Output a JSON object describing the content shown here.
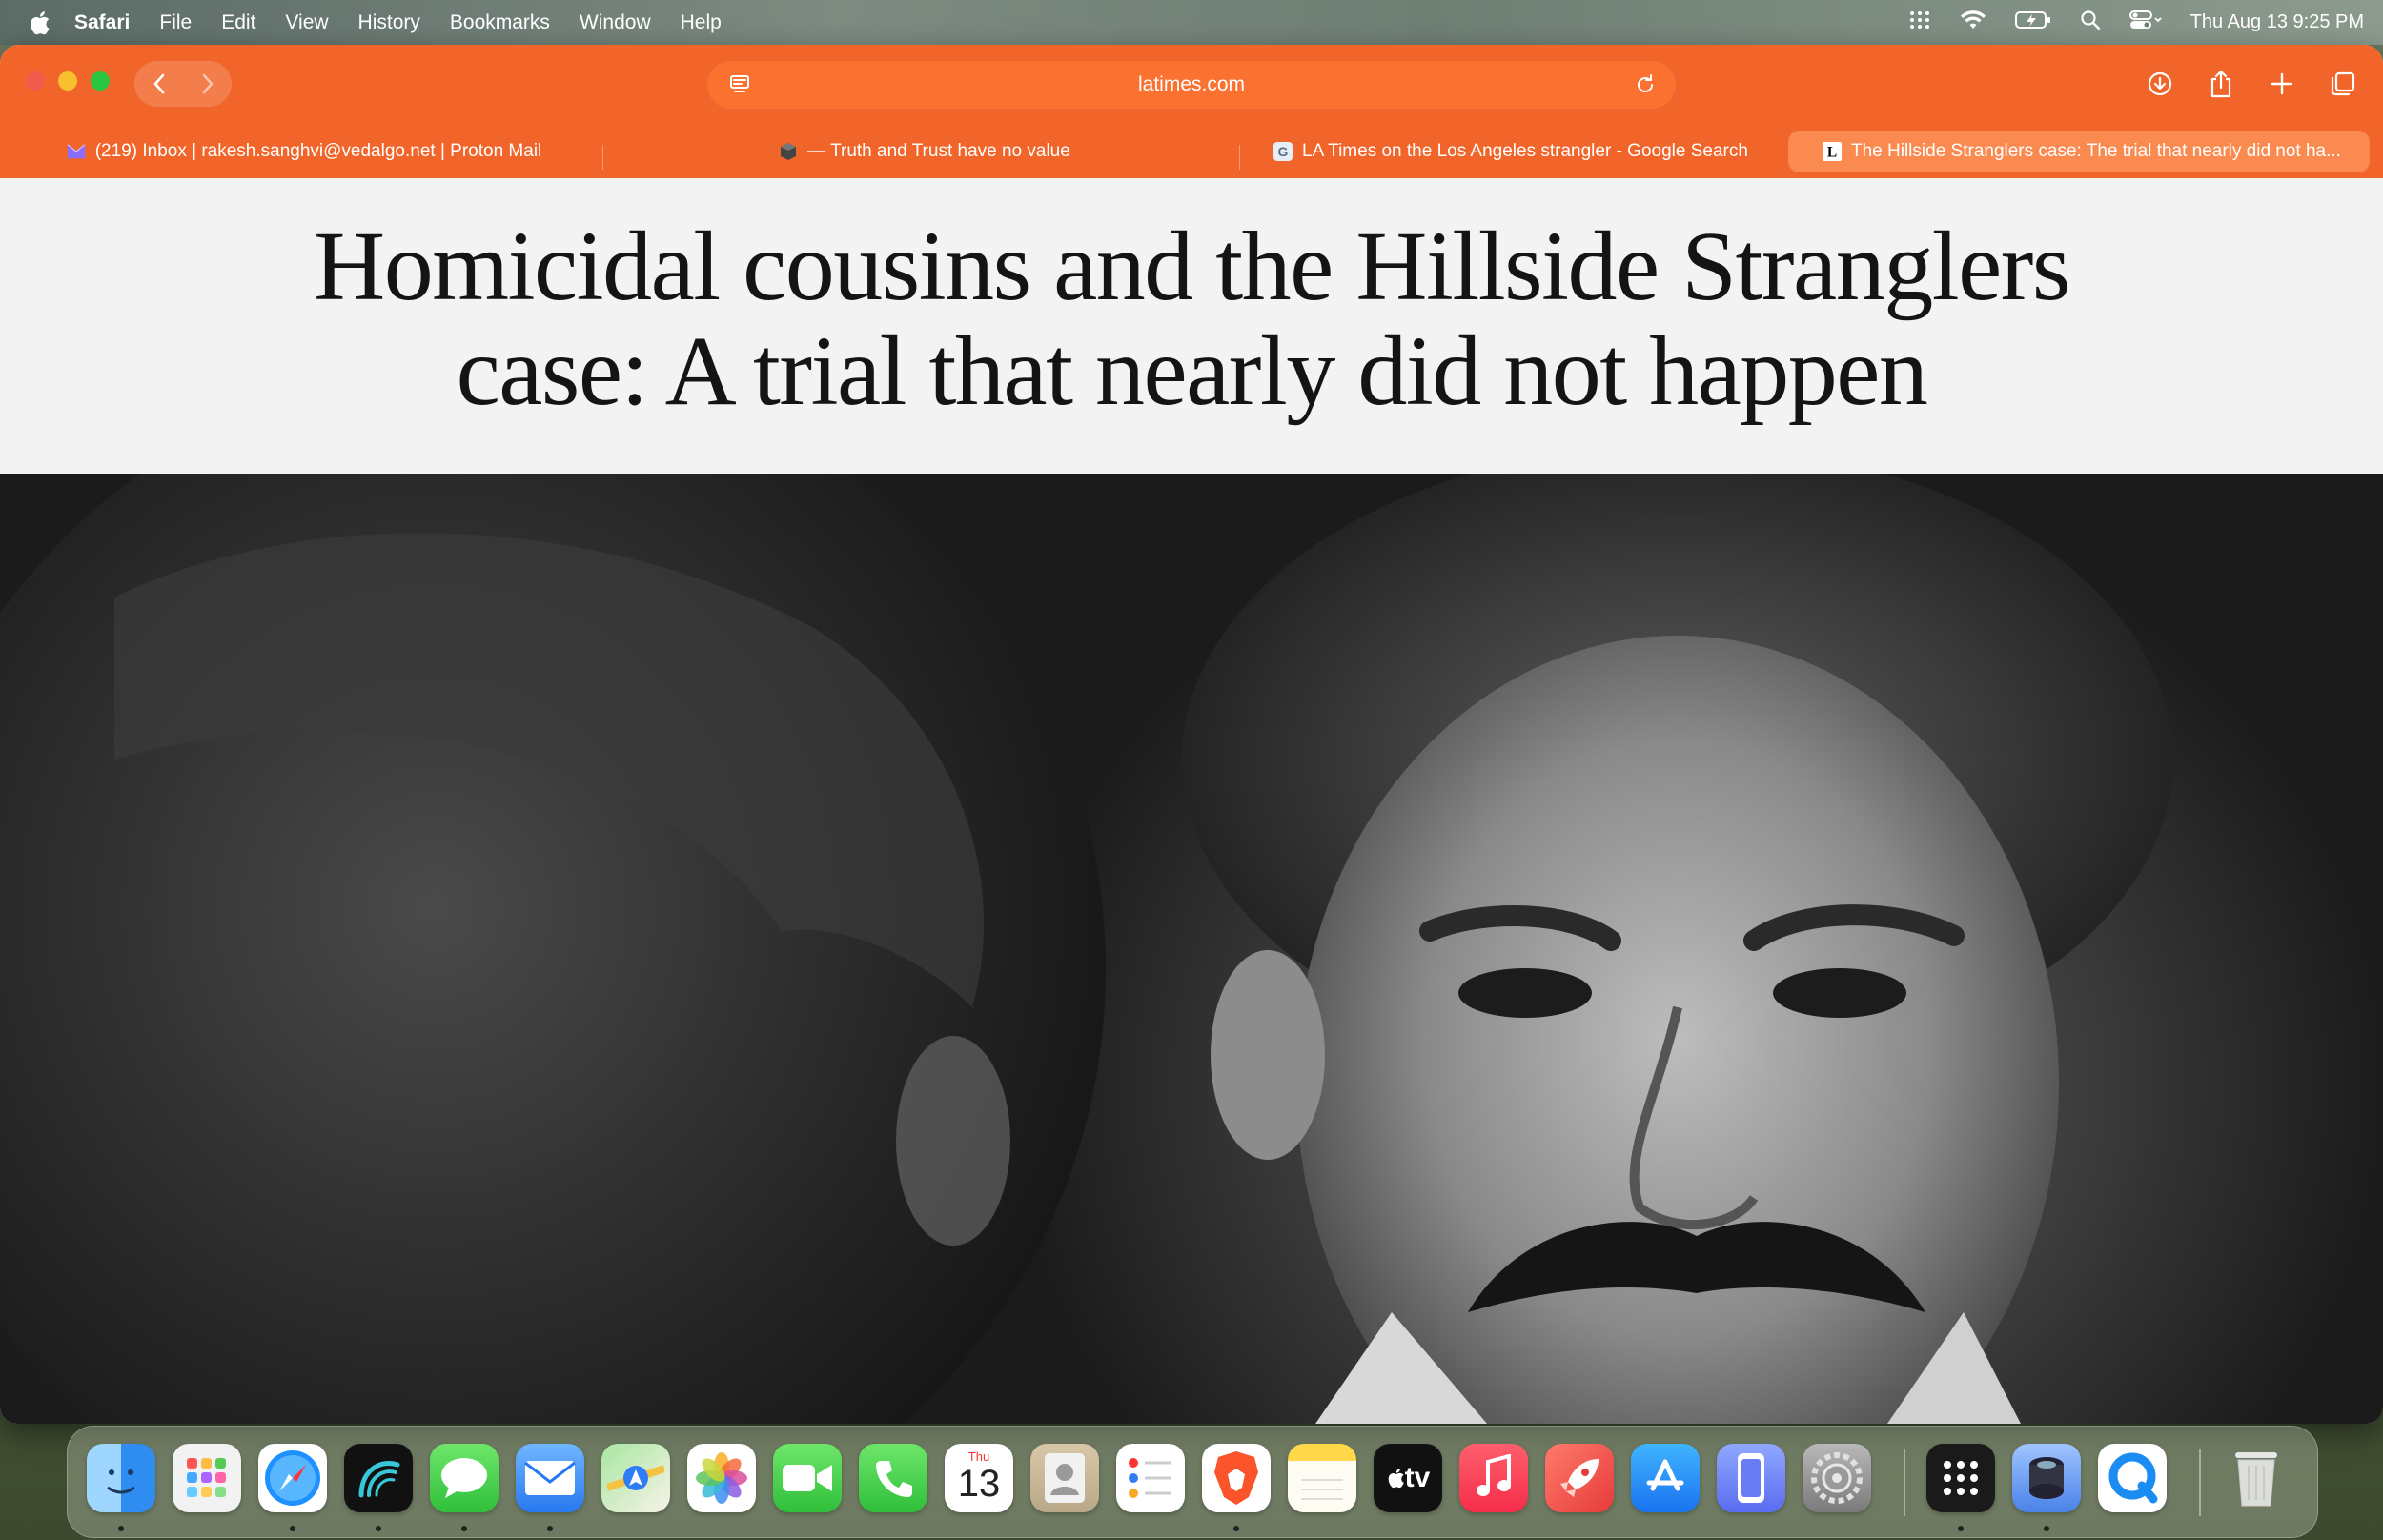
{
  "menubar": {
    "app_name": "Safari",
    "menus": [
      "File",
      "Edit",
      "View",
      "History",
      "Bookmarks",
      "Window",
      "Help"
    ],
    "clock": "Thu Aug 13  9:25 PM"
  },
  "browser": {
    "accent_color": "#f2652a",
    "url": "latimes.com",
    "tabs": [
      {
        "title": "(219) Inbox | rakesh.sanghvi@vedalgo.net | Proton Mail",
        "favicon": "proton-mail-icon"
      },
      {
        "title": "— Truth and Trust have no value",
        "favicon": "cube-icon"
      },
      {
        "title": "LA Times on the Los Angeles strangler - Google Search",
        "favicon": "google-icon"
      },
      {
        "title": "The Hillside Stranglers case: The trial that nearly did not ha...",
        "favicon": "latimes-icon",
        "active": true
      }
    ]
  },
  "article": {
    "headline_line1": "Homicidal cousins and the Hillside Stranglers",
    "headline_line2": "case: A trial that nearly did not happen"
  },
  "calendar_icon": {
    "month": "Thu",
    "day": "13"
  },
  "appletv_label": "tv",
  "dock": {
    "apps": [
      "Finder",
      "Launchpad",
      "Safari",
      "Podcasts-like",
      "Messages",
      "Mail",
      "Maps",
      "Photos",
      "FaceTime",
      "Phone",
      "Calendar",
      "Contacts",
      "Reminders",
      "Brave",
      "Notes",
      "Apple TV",
      "Music",
      "Rocket",
      "App Store",
      "iPhone Mirroring",
      "System Settings",
      "Grid",
      "Disk",
      "QuickTime",
      "Trash"
    ]
  }
}
